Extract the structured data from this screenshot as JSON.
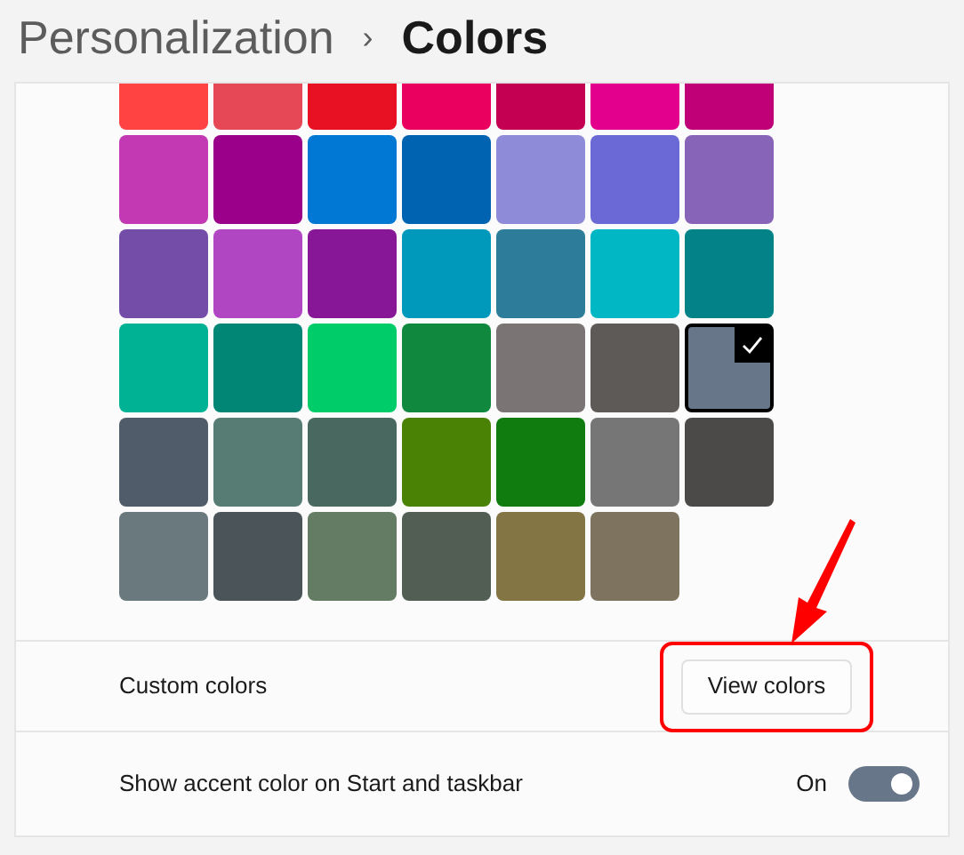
{
  "breadcrumb": {
    "parent": "Personalization",
    "separator": "›",
    "current": "Colors"
  },
  "swatches": [
    {
      "color": "#ff4343",
      "selected": false
    },
    {
      "color": "#e74856",
      "selected": false
    },
    {
      "color": "#e81123",
      "selected": false
    },
    {
      "color": "#ea005e",
      "selected": false
    },
    {
      "color": "#c30052",
      "selected": false
    },
    {
      "color": "#e3008c",
      "selected": false
    },
    {
      "color": "#bf0077",
      "selected": false
    },
    {
      "color": "#c239b3",
      "selected": false
    },
    {
      "color": "#9a0089",
      "selected": false
    },
    {
      "color": "#0078d4",
      "selected": false
    },
    {
      "color": "#0063b1",
      "selected": false
    },
    {
      "color": "#8e8cd8",
      "selected": false
    },
    {
      "color": "#6b69d6",
      "selected": false
    },
    {
      "color": "#8764b8",
      "selected": false
    },
    {
      "color": "#744da9",
      "selected": false
    },
    {
      "color": "#b146c2",
      "selected": false
    },
    {
      "color": "#881798",
      "selected": false
    },
    {
      "color": "#0099bc",
      "selected": false
    },
    {
      "color": "#2d7d9a",
      "selected": false
    },
    {
      "color": "#00b7c3",
      "selected": false
    },
    {
      "color": "#038387",
      "selected": false
    },
    {
      "color": "#00b294",
      "selected": false
    },
    {
      "color": "#018574",
      "selected": false
    },
    {
      "color": "#00cc6a",
      "selected": false
    },
    {
      "color": "#10893e",
      "selected": false
    },
    {
      "color": "#7a7574",
      "selected": false
    },
    {
      "color": "#5d5a58",
      "selected": false
    },
    {
      "color": "#68768a",
      "selected": true
    },
    {
      "color": "#515c6b",
      "selected": false
    },
    {
      "color": "#567c73",
      "selected": false
    },
    {
      "color": "#486860",
      "selected": false
    },
    {
      "color": "#498205",
      "selected": false
    },
    {
      "color": "#107c10",
      "selected": false
    },
    {
      "color": "#767676",
      "selected": false
    },
    {
      "color": "#4c4a48",
      "selected": false
    },
    {
      "color": "#69797e",
      "selected": false
    },
    {
      "color": "#4a5459",
      "selected": false
    },
    {
      "color": "#647c64",
      "selected": false
    },
    {
      "color": "#525e54",
      "selected": false
    },
    {
      "color": "#847545",
      "selected": false
    },
    {
      "color": "#7e735f",
      "selected": false
    }
  ],
  "custom_colors": {
    "label": "Custom colors",
    "button": "View colors",
    "highlighted": true
  },
  "accent_on_start": {
    "label": "Show accent color on Start and taskbar",
    "state_text": "On",
    "on": true
  }
}
